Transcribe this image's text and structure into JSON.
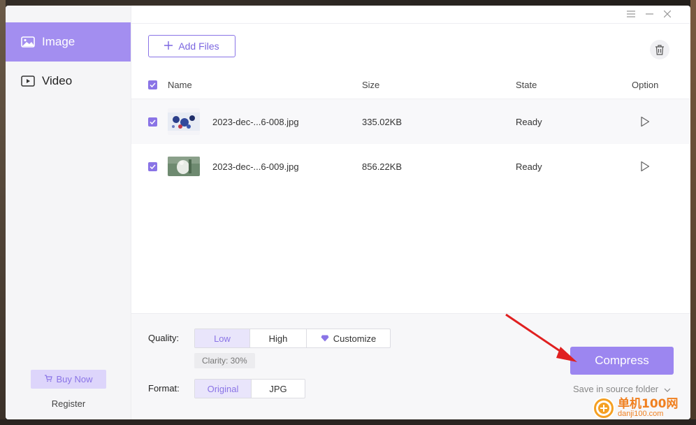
{
  "sidebar": {
    "items": [
      {
        "label": "Image",
        "icon": "image-icon",
        "active": true
      },
      {
        "label": "Video",
        "icon": "video-icon",
        "active": false
      }
    ],
    "buy_now": "Buy Now",
    "register": "Register"
  },
  "toolbar": {
    "add_files": "Add Files"
  },
  "table": {
    "headers": {
      "name": "Name",
      "size": "Size",
      "state": "State",
      "option": "Option"
    },
    "rows": [
      {
        "name": "2023-dec-...6-008.jpg",
        "size": "335.02KB",
        "state": "Ready"
      },
      {
        "name": "2023-dec-...6-009.jpg",
        "size": "856.22KB",
        "state": "Ready"
      }
    ]
  },
  "settings": {
    "quality_label": "Quality:",
    "quality_options": [
      "Low",
      "High",
      "Customize"
    ],
    "quality_selected": "Low",
    "clarity": "Clarity: 30%",
    "format_label": "Format:",
    "format_options": [
      "Original",
      "JPG"
    ],
    "format_selected": "Original"
  },
  "actions": {
    "compress": "Compress",
    "save_location": "Save in source folder"
  },
  "watermark": {
    "cn": "单机100网",
    "url": "danji100.com"
  },
  "colors": {
    "accent": "#a38ef0",
    "accent_text": "#8a74e6",
    "annotation_arrow": "#e02020"
  }
}
